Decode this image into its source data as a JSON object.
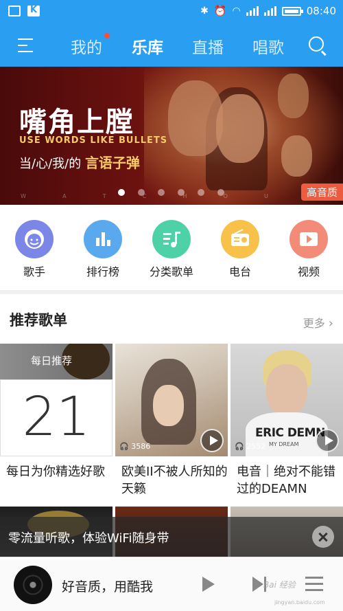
{
  "status_bar": {
    "time": "08:40"
  },
  "nav": {
    "tabs": [
      {
        "label": "我的",
        "has_dot": true
      },
      {
        "label": "乐库",
        "active": true
      },
      {
        "label": "直播"
      },
      {
        "label": "唱歌"
      }
    ]
  },
  "banner": {
    "title": "嘴角上膛",
    "english": "USE WORDS LIKE BULLETS",
    "subtitle_prefix": "当/心/我/的",
    "subtitle_highlight": "言语子弹",
    "letters": [
      "W",
      "A",
      "T",
      "C",
      "H",
      "O",
      "U",
      "T"
    ],
    "badge": "高音质",
    "slide_count": 6,
    "active_slide": 0
  },
  "categories": [
    {
      "label": "歌手",
      "icon": "singer-icon",
      "color": "#7b86e6"
    },
    {
      "label": "排行榜",
      "icon": "chart-icon",
      "color": "#5aa9ef"
    },
    {
      "label": "分类歌单",
      "icon": "music-list-icon",
      "color": "#4fd1a8"
    },
    {
      "label": "电台",
      "icon": "radio-icon",
      "color": "#f7c14a"
    },
    {
      "label": "视频",
      "icon": "video-icon",
      "color": "#f28b78"
    }
  ],
  "recommend": {
    "title": "推荐歌单",
    "more": "更多",
    "playlists": [
      {
        "title": "每日为你精选好歌",
        "badge": "每日推荐",
        "date": "21"
      },
      {
        "title": "欧美II不被人所知的天籁",
        "plays": "3586"
      },
      {
        "title": "电音｜绝对不能错过的DEAMN",
        "plays": "2552",
        "cover_text": "ERIC DEMN",
        "cover_sub": "MY DREAM"
      }
    ]
  },
  "toast": {
    "text": "零流量听歌，体验WiFi随身带"
  },
  "player": {
    "text": "好音质，用酷我"
  },
  "watermark": {
    "text": "Bai 经验",
    "url": "jingyan.baidu.com"
  }
}
